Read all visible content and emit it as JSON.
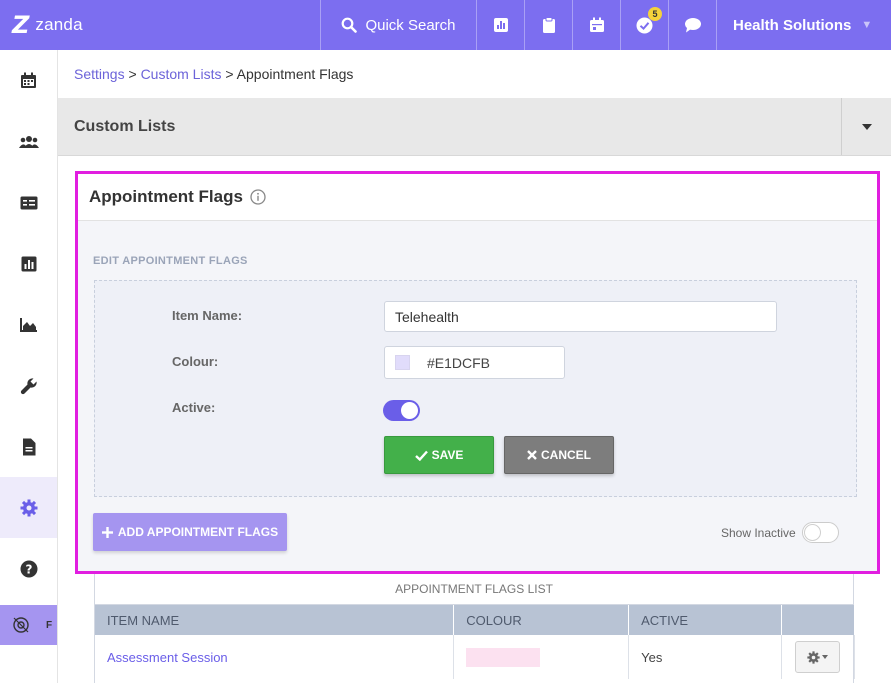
{
  "topbar": {
    "logo_text": "zanda",
    "quick_search_label": "Quick Search",
    "notification_count": "5",
    "company_name": "Health Solutions"
  },
  "sidebar": {
    "items": [
      {
        "icon": "calendar-icon"
      },
      {
        "icon": "users-icon"
      },
      {
        "icon": "id-card-icon"
      },
      {
        "icon": "bar-chart-icon"
      },
      {
        "icon": "area-chart-icon"
      },
      {
        "icon": "wrench-icon"
      },
      {
        "icon": "document-icon"
      },
      {
        "icon": "gear-icon",
        "active": true
      },
      {
        "icon": "help-icon"
      }
    ],
    "user_initial": "F"
  },
  "breadcrumb": {
    "settings": "Settings",
    "sep1": " > ",
    "custom_lists": "Custom Lists",
    "sep2": " > ",
    "current": "Appointment Flags"
  },
  "section": {
    "title": "Custom Lists"
  },
  "card": {
    "title": "Appointment Flags",
    "subtitle": "EDIT APPOINTMENT FLAGS",
    "form": {
      "item_name_label": "Item Name:",
      "item_name_value": "Telehealth",
      "colour_label": "Colour:",
      "colour_value": "#E1DCFB",
      "active_label": "Active:",
      "active": true,
      "save_label": "SAVE",
      "cancel_label": "CANCEL"
    },
    "add_label": "ADD APPOINTMENT FLAGS",
    "show_inactive_label": "Show Inactive",
    "show_inactive": false
  },
  "list": {
    "caption": "APPOINTMENT FLAGS LIST",
    "columns": [
      "ITEM NAME",
      "COLOUR",
      "ACTIVE",
      ""
    ],
    "rows": [
      {
        "name": "Assessment Session",
        "colour": "#FCE1F0",
        "active": "Yes"
      }
    ]
  },
  "colors": {
    "brand": "#7C6EF0",
    "highlight": "#E11EE0",
    "save": "#43B04A",
    "cancel": "#7D7D7D",
    "add": "#A595F0"
  }
}
